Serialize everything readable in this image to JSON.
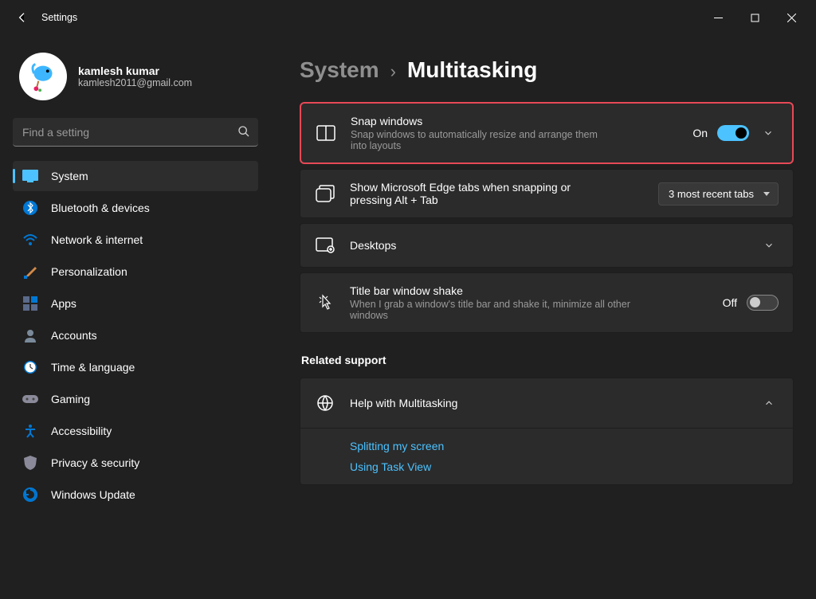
{
  "app": {
    "title": "Settings"
  },
  "user": {
    "name": "kamlesh kumar",
    "email": "kamlesh2011@gmail.com"
  },
  "search": {
    "placeholder": "Find a setting"
  },
  "nav": {
    "system": "System",
    "bluetooth": "Bluetooth & devices",
    "network": "Network & internet",
    "personalization": "Personalization",
    "apps": "Apps",
    "accounts": "Accounts",
    "time": "Time & language",
    "gaming": "Gaming",
    "accessibility": "Accessibility",
    "privacy": "Privacy & security",
    "update": "Windows Update"
  },
  "breadcrumb": {
    "parent": "System",
    "sep": "›",
    "current": "Multitasking"
  },
  "cards": {
    "snap": {
      "title": "Snap windows",
      "desc": "Snap windows to automatically resize and arrange them into layouts",
      "state_label": "On"
    },
    "edge": {
      "title": "Show Microsoft Edge tabs when snapping or pressing Alt + Tab",
      "dropdown": "3 most recent tabs"
    },
    "desktops": {
      "title": "Desktops"
    },
    "shake": {
      "title": "Title bar window shake",
      "desc": "When I grab a window's title bar and shake it, minimize all other windows",
      "state_label": "Off"
    }
  },
  "related": {
    "header": "Related support",
    "help_title": "Help with Multitasking",
    "links": {
      "split": "Splitting my screen",
      "taskview": "Using Task View"
    }
  }
}
